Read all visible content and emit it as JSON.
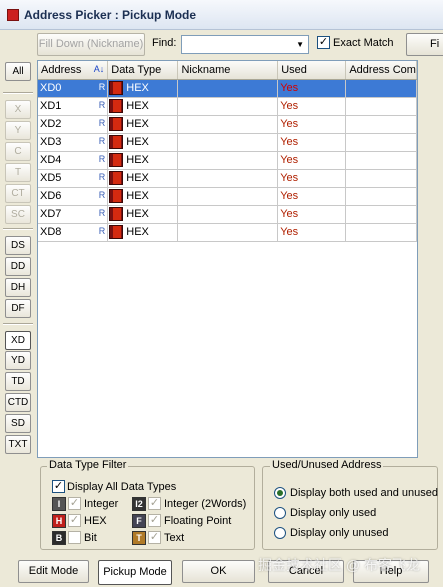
{
  "window": {
    "title": "Address Picker : Pickup Mode"
  },
  "toolbar": {
    "fill_down_label": "Fill Down (Nickname)",
    "find_label": "Find:",
    "find_value": "",
    "exact_match_label": "Exact Match",
    "exact_match_checked": true,
    "find_button_label": "Fi"
  },
  "side_buttons": [
    {
      "label": "All",
      "enabled": true
    },
    {
      "label": "X",
      "enabled": false
    },
    {
      "label": "Y",
      "enabled": false
    },
    {
      "label": "C",
      "enabled": false
    },
    {
      "label": "T",
      "enabled": false
    },
    {
      "label": "CT",
      "enabled": false
    },
    {
      "label": "SC",
      "enabled": false
    },
    {
      "label": "DS",
      "enabled": true
    },
    {
      "label": "DD",
      "enabled": true
    },
    {
      "label": "DH",
      "enabled": true
    },
    {
      "label": "DF",
      "enabled": true
    },
    {
      "label": "XD",
      "enabled": true
    },
    {
      "label": "YD",
      "enabled": true
    },
    {
      "label": "TD",
      "enabled": true
    },
    {
      "label": "CTD",
      "enabled": true
    },
    {
      "label": "SD",
      "enabled": true
    },
    {
      "label": "TXT",
      "enabled": true
    }
  ],
  "grid": {
    "columns": [
      "Address",
      "Data Type",
      "Nickname",
      "Used",
      "Address Com"
    ],
    "sort_indicator": "A↓",
    "rows": [
      {
        "address": "XD0",
        "flag": "R",
        "type": "HEX",
        "nickname": "",
        "used": "Yes",
        "comment": "",
        "selected": true
      },
      {
        "address": "XD1",
        "flag": "R",
        "type": "HEX",
        "nickname": "",
        "used": "Yes",
        "comment": ""
      },
      {
        "address": "XD2",
        "flag": "R",
        "type": "HEX",
        "nickname": "",
        "used": "Yes",
        "comment": ""
      },
      {
        "address": "XD3",
        "flag": "R",
        "type": "HEX",
        "nickname": "",
        "used": "Yes",
        "comment": ""
      },
      {
        "address": "XD4",
        "flag": "R",
        "type": "HEX",
        "nickname": "",
        "used": "Yes",
        "comment": ""
      },
      {
        "address": "XD5",
        "flag": "R",
        "type": "HEX",
        "nickname": "",
        "used": "Yes",
        "comment": ""
      },
      {
        "address": "XD6",
        "flag": "R",
        "type": "HEX",
        "nickname": "",
        "used": "Yes",
        "comment": ""
      },
      {
        "address": "XD7",
        "flag": "R",
        "type": "HEX",
        "nickname": "",
        "used": "Yes",
        "comment": ""
      },
      {
        "address": "XD8",
        "flag": "R",
        "type": "HEX",
        "nickname": "",
        "used": "Yes",
        "comment": ""
      }
    ]
  },
  "data_type_filter": {
    "title": "Data Type Filter",
    "display_all_label": "Display All Data Types",
    "display_all_checked": true,
    "items": {
      "integer": {
        "label": "Integer",
        "icon_letter": "I",
        "color": "#555555"
      },
      "integer2": {
        "label": "Integer (2Words)",
        "icon_letter": "I2",
        "color": "#333333"
      },
      "hex": {
        "label": "HEX",
        "icon_letter": "H",
        "color": "#c0201c"
      },
      "floating": {
        "label": "Floating Point",
        "icon_letter": "F",
        "color": "#444455"
      },
      "bit": {
        "label": "Bit",
        "icon_letter": "B",
        "color": "#2b2b2b"
      },
      "text": {
        "label": "Text",
        "icon_letter": "T",
        "color": "#b07a28"
      }
    }
  },
  "used_filter": {
    "title": "Used/Unused Address",
    "options": [
      {
        "label": "Display both used and unused",
        "selected": true
      },
      {
        "label": "Display only used",
        "selected": false
      },
      {
        "label": "Display only unused",
        "selected": false
      }
    ]
  },
  "footer": {
    "edit_mode_label": "Edit Mode",
    "pickup_mode_label": "Pickup Mode",
    "ok_label": "OK",
    "cancel_label": "Cancel",
    "help_label": "Help"
  },
  "watermark": "掘金技术社区 @ 布客飞龙",
  "colors": {
    "selection": "#3d7ad5",
    "used_text": "#b02000",
    "hex_icon": "#d42a10"
  }
}
